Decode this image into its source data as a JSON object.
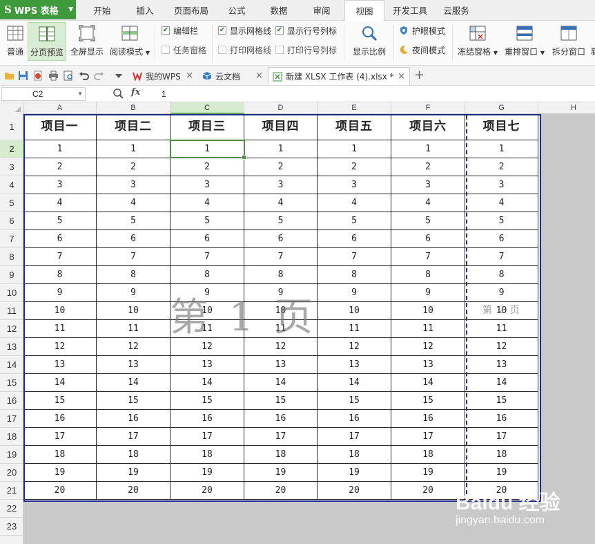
{
  "app": {
    "title": "WPS 表格",
    "logo_glyph": "S",
    "accent": "#3f9a3c"
  },
  "menu": {
    "tabs": [
      "开始",
      "插入",
      "页面布局",
      "公式",
      "数据",
      "审阅",
      "视图",
      "开发工具",
      "云服务"
    ],
    "active_tab": "视图"
  },
  "ribbon": {
    "normal": "普通",
    "page_break_preview": "分页预览",
    "full_screen": "全屏显示",
    "reading_mode": "阅读模式",
    "edit_bar": "编辑栏",
    "task_pane": "任务窗格",
    "show_gridlines": "显示网格线",
    "print_gridlines": "打印网格线",
    "show_row_col_headers": "显示行号列标",
    "print_row_col_headers": "打印行号列标",
    "zoom": "显示比例",
    "eye_protection": "护眼模式",
    "night_mode": "夜间模式",
    "freeze_panes": "冻结窗格",
    "arrange_windows": "重排窗口",
    "split_window": "拆分窗口",
    "cut_off": "新"
  },
  "tabbar": {
    "tabs": [
      {
        "label": "我的WPS",
        "icon": "wps-logo-icon"
      },
      {
        "label": "云文档",
        "icon": "cloud-cube-icon"
      },
      {
        "label": "新建 XLSX 工作表 (4).xlsx *",
        "icon": "spreadsheet-icon"
      }
    ],
    "close_glyph": "×",
    "new_tab_glyph": "+"
  },
  "formula_bar": {
    "name_box": "C2",
    "fx_label": "fx",
    "value": "1"
  },
  "sheet": {
    "columns": [
      "A",
      "B",
      "C",
      "D",
      "E",
      "F",
      "G",
      "H"
    ],
    "selected_column": "C",
    "rows": [
      "1",
      "2",
      "3",
      "4",
      "5",
      "6",
      "7",
      "8",
      "9",
      "10",
      "11",
      "12",
      "13",
      "14",
      "15",
      "16",
      "17",
      "18",
      "19",
      "20",
      "21",
      "22",
      "23"
    ],
    "selected_row": "2",
    "headers": [
      "项目一",
      "项目二",
      "项目三",
      "项目四",
      "项目五",
      "项目六",
      "项目七"
    ],
    "values": [
      1,
      2,
      3,
      4,
      5,
      6,
      7,
      8,
      9,
      10,
      11,
      12,
      13,
      14,
      15,
      16,
      17,
      18,
      19,
      20
    ],
    "page1_label": "第 1 页",
    "page2_label": "第 2 页"
  },
  "watermark": {
    "line1": "Baidu 经验",
    "line2": "jingyan.baidu.com"
  }
}
